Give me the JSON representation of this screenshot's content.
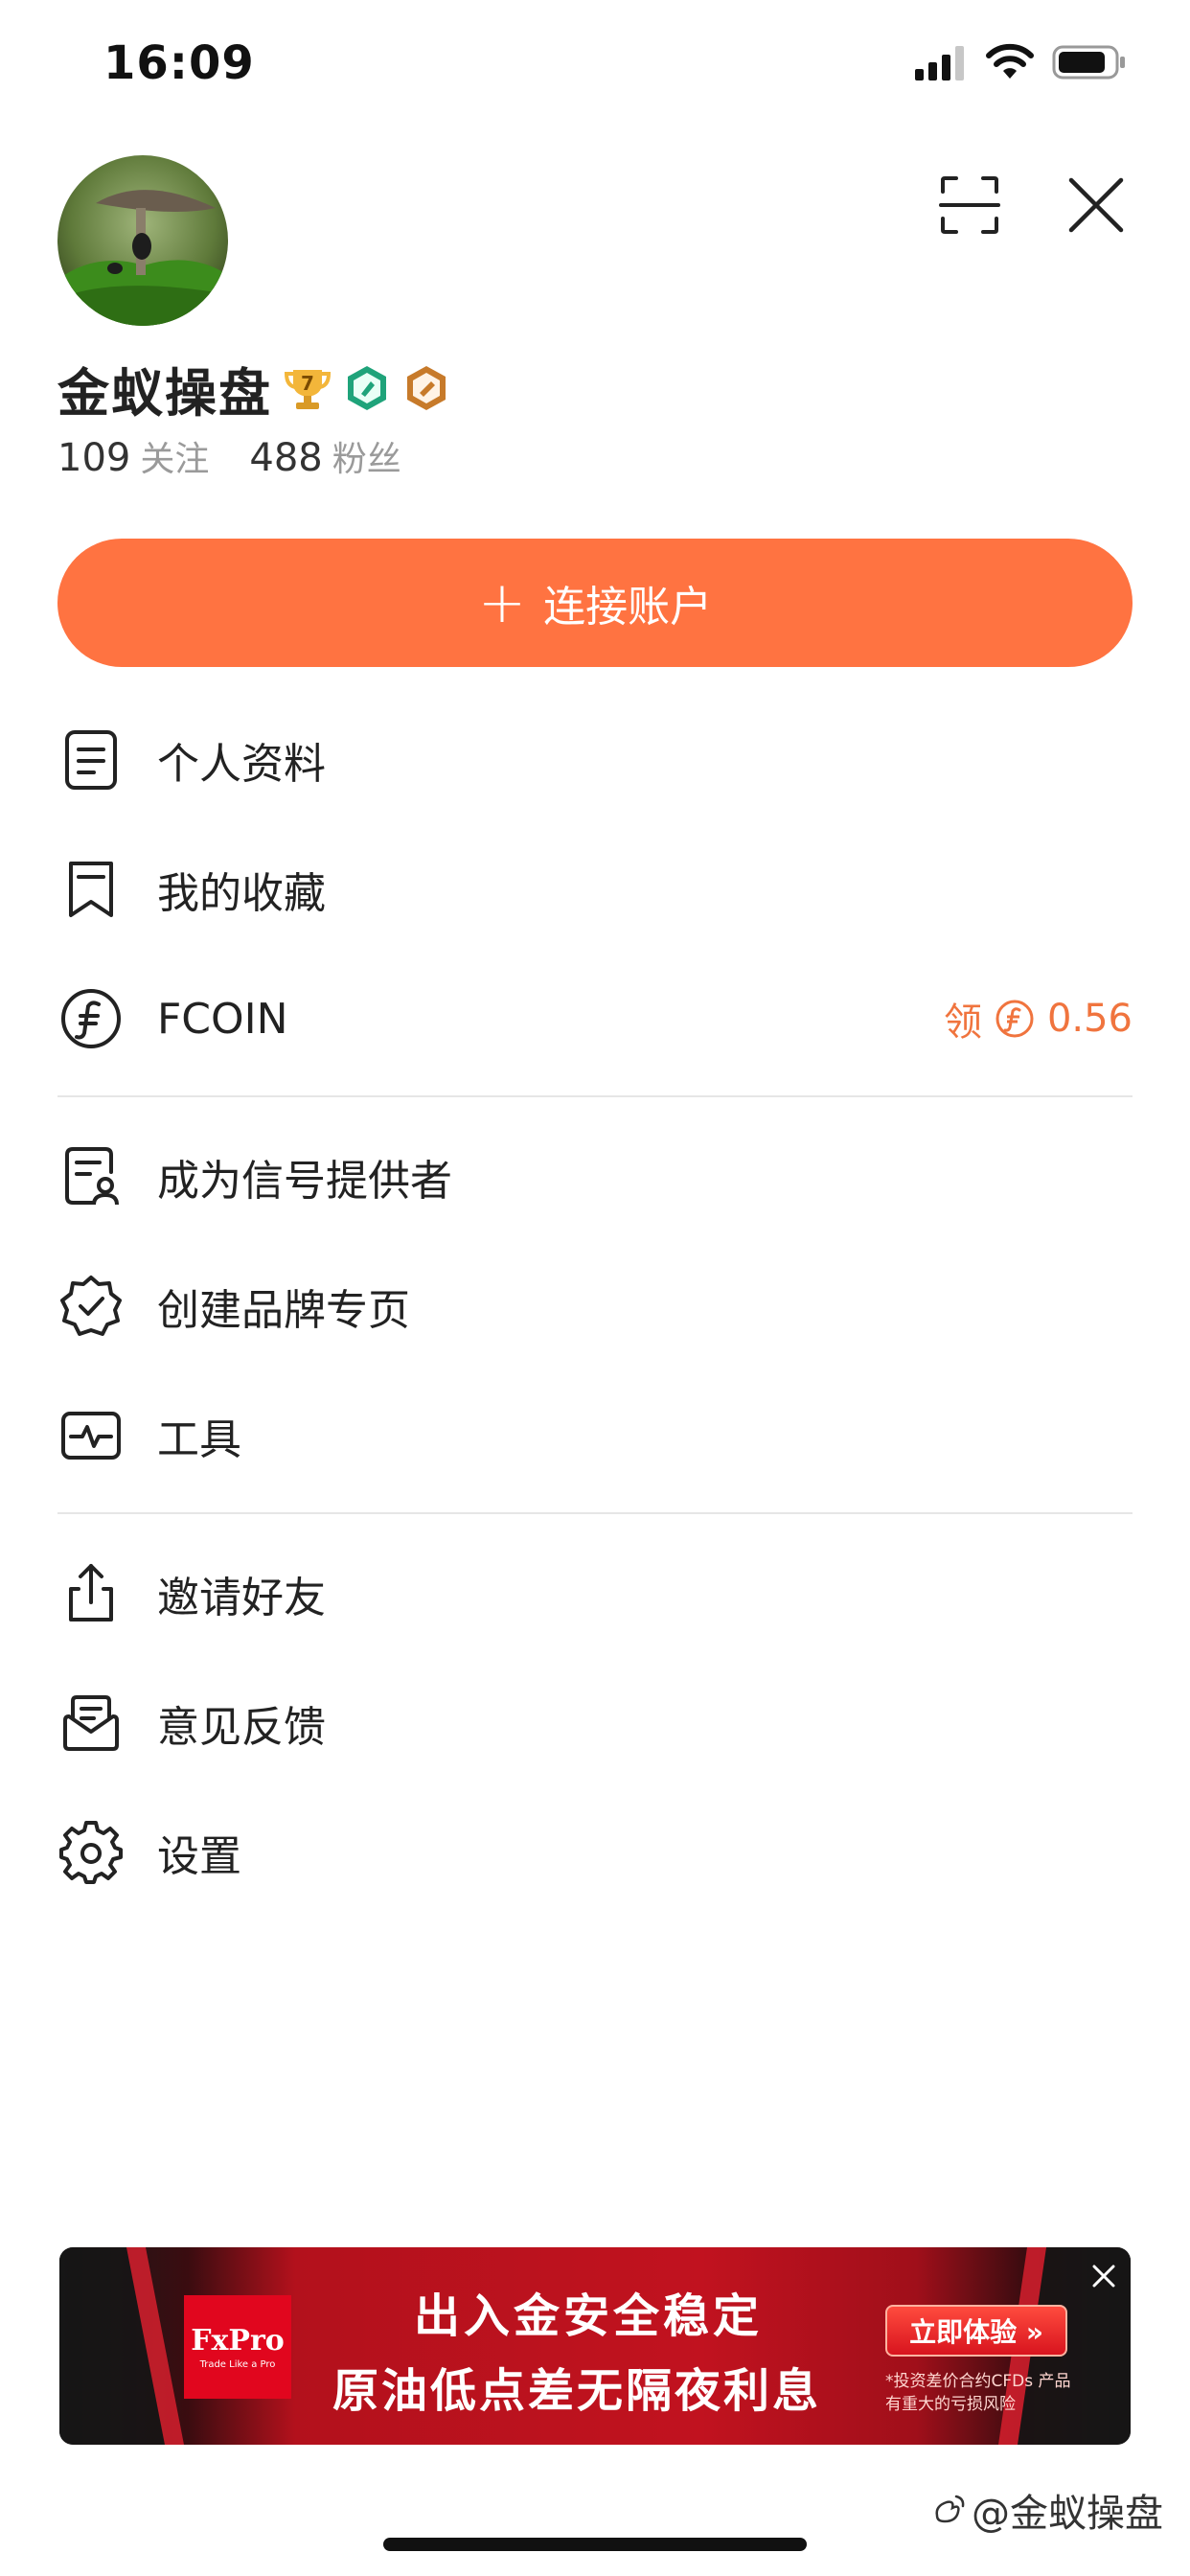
{
  "status_bar": {
    "time": "16:09"
  },
  "profile": {
    "username": "金蚁操盘",
    "following_count": "109",
    "following_label": "关注",
    "followers_count": "488",
    "followers_label": "粉丝",
    "badges": [
      "trophy-level-7-icon",
      "green-badge-icon",
      "bronze-badge-icon"
    ],
    "level_number": "7"
  },
  "connect_button": {
    "plus": "+",
    "label": "连接账户"
  },
  "menu": {
    "group1": [
      {
        "label": "个人资料",
        "icon": "profile-document-icon"
      },
      {
        "label": "我的收藏",
        "icon": "bookmark-icon"
      },
      {
        "label": "FCOIN",
        "icon": "fcoin-icon",
        "right_prefix": "领",
        "right_value": "0.56"
      }
    ],
    "group2": [
      {
        "label": "成为信号提供者",
        "icon": "signal-provider-icon"
      },
      {
        "label": "创建品牌专页",
        "icon": "verified-badge-icon"
      },
      {
        "label": "工具",
        "icon": "pulse-monitor-icon"
      }
    ],
    "group3": [
      {
        "label": "邀请好友",
        "icon": "share-icon"
      },
      {
        "label": "意见反馈",
        "icon": "feedback-icon"
      },
      {
        "label": "设置",
        "icon": "gear-icon"
      }
    ]
  },
  "ad": {
    "logo_brand": "FxPro",
    "logo_sub": "Trade Like a Pro",
    "line1": "出入金安全稳定",
    "line2": "原油低点差无隔夜利息",
    "cta": "立即体验 »",
    "disclaimer": "*投资差价合约CFDs 产品有重大的亏损风险"
  },
  "watermark": "@金蚁操盘",
  "colors": {
    "accent": "#FF7341",
    "fcoin": "#F0743E",
    "divider": "#e6e6e6"
  }
}
